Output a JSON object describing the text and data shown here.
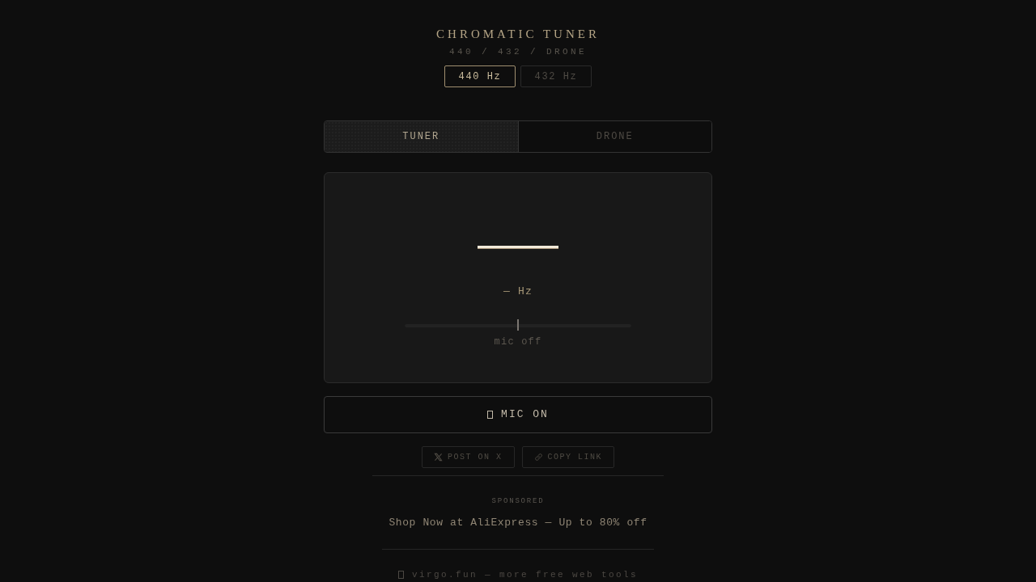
{
  "header": {
    "title": "CHROMATIC TUNER",
    "subtitle": "440 / 432 / DRONE"
  },
  "reference_buttons": [
    {
      "label": "440 Hz",
      "selected": true
    },
    {
      "label": "432 Hz",
      "selected": false
    }
  ],
  "tabs": [
    {
      "label": "TUNER",
      "selected": true
    },
    {
      "label": "DRONE",
      "selected": false
    }
  ],
  "tuner": {
    "frequency": "— Hz",
    "meter": {
      "level": 0.5
    },
    "status": "mic off"
  },
  "mic_button": {
    "label": "MIC ON"
  },
  "share_buttons": [
    {
      "kind": "x",
      "label": "POST ON X"
    },
    {
      "kind": "link",
      "label": "COPY LINK"
    }
  ],
  "sponsored": {
    "label": "SPONSORED",
    "link": "Shop Now at AliExpress — Up to 80% off"
  },
  "footer": {
    "text": "virgo.fun — more free web tools"
  }
}
